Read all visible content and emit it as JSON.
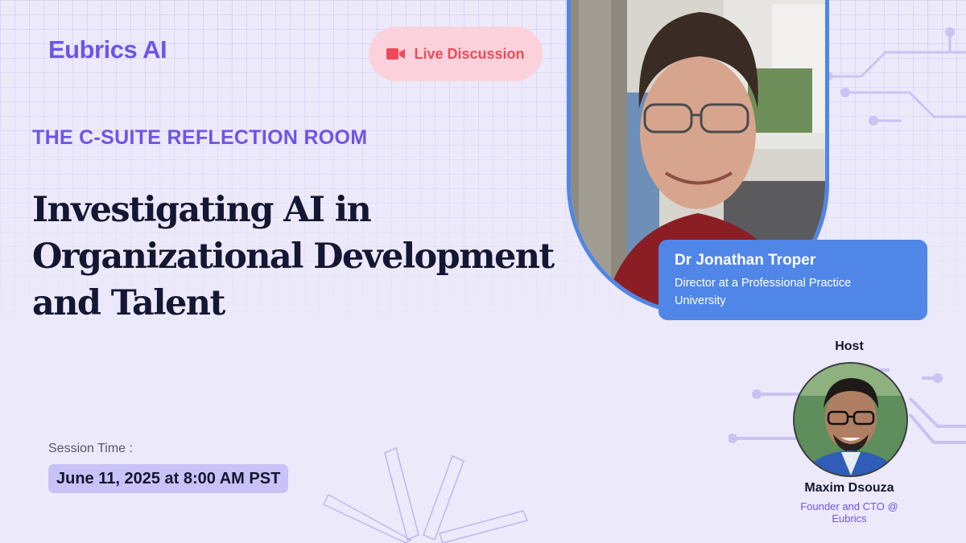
{
  "brand": {
    "name": "Eubrics AI",
    "color": "#6C55E8"
  },
  "badge": {
    "label": "Live Discussion",
    "icon": "video-camera-icon",
    "color": "#EE4A5B",
    "background": "#FBD2DB"
  },
  "series_title": "THE C-SUITE REFLECTION ROOM",
  "headline": "Investigating AI in Organizational Development and Talent",
  "session": {
    "label": "Session Time :",
    "value": "June 11, 2025 at 8:00 AM PST"
  },
  "speaker": {
    "name": "Dr Jonathan Troper",
    "title": "Director at a Professional Practice University",
    "accent": "#4F86E8"
  },
  "host": {
    "label": "Host",
    "name": "Maxim Dsouza",
    "title": "Founder and CTO @ Eubrics"
  }
}
